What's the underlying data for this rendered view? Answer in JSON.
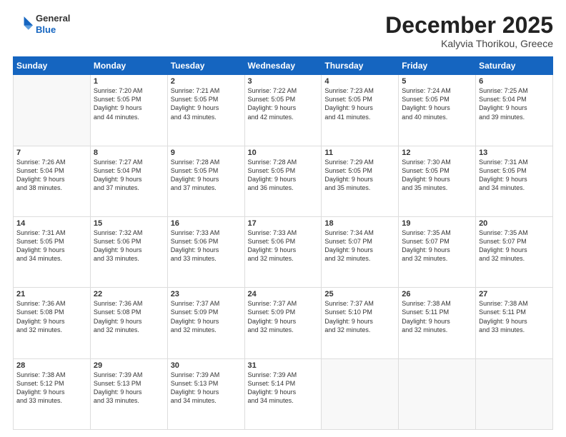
{
  "logo": {
    "general": "General",
    "blue": "Blue"
  },
  "header": {
    "month_year": "December 2025",
    "location": "Kalyvia Thorikou, Greece"
  },
  "days_of_week": [
    "Sunday",
    "Monday",
    "Tuesday",
    "Wednesday",
    "Thursday",
    "Friday",
    "Saturday"
  ],
  "weeks": [
    [
      {
        "day": "",
        "info": ""
      },
      {
        "day": "1",
        "info": "Sunrise: 7:20 AM\nSunset: 5:05 PM\nDaylight: 9 hours\nand 44 minutes."
      },
      {
        "day": "2",
        "info": "Sunrise: 7:21 AM\nSunset: 5:05 PM\nDaylight: 9 hours\nand 43 minutes."
      },
      {
        "day": "3",
        "info": "Sunrise: 7:22 AM\nSunset: 5:05 PM\nDaylight: 9 hours\nand 42 minutes."
      },
      {
        "day": "4",
        "info": "Sunrise: 7:23 AM\nSunset: 5:05 PM\nDaylight: 9 hours\nand 41 minutes."
      },
      {
        "day": "5",
        "info": "Sunrise: 7:24 AM\nSunset: 5:05 PM\nDaylight: 9 hours\nand 40 minutes."
      },
      {
        "day": "6",
        "info": "Sunrise: 7:25 AM\nSunset: 5:04 PM\nDaylight: 9 hours\nand 39 minutes."
      }
    ],
    [
      {
        "day": "7",
        "info": "Sunrise: 7:26 AM\nSunset: 5:04 PM\nDaylight: 9 hours\nand 38 minutes."
      },
      {
        "day": "8",
        "info": "Sunrise: 7:27 AM\nSunset: 5:04 PM\nDaylight: 9 hours\nand 37 minutes."
      },
      {
        "day": "9",
        "info": "Sunrise: 7:28 AM\nSunset: 5:05 PM\nDaylight: 9 hours\nand 37 minutes."
      },
      {
        "day": "10",
        "info": "Sunrise: 7:28 AM\nSunset: 5:05 PM\nDaylight: 9 hours\nand 36 minutes."
      },
      {
        "day": "11",
        "info": "Sunrise: 7:29 AM\nSunset: 5:05 PM\nDaylight: 9 hours\nand 35 minutes."
      },
      {
        "day": "12",
        "info": "Sunrise: 7:30 AM\nSunset: 5:05 PM\nDaylight: 9 hours\nand 35 minutes."
      },
      {
        "day": "13",
        "info": "Sunrise: 7:31 AM\nSunset: 5:05 PM\nDaylight: 9 hours\nand 34 minutes."
      }
    ],
    [
      {
        "day": "14",
        "info": "Sunrise: 7:31 AM\nSunset: 5:05 PM\nDaylight: 9 hours\nand 34 minutes."
      },
      {
        "day": "15",
        "info": "Sunrise: 7:32 AM\nSunset: 5:06 PM\nDaylight: 9 hours\nand 33 minutes."
      },
      {
        "day": "16",
        "info": "Sunrise: 7:33 AM\nSunset: 5:06 PM\nDaylight: 9 hours\nand 33 minutes."
      },
      {
        "day": "17",
        "info": "Sunrise: 7:33 AM\nSunset: 5:06 PM\nDaylight: 9 hours\nand 32 minutes."
      },
      {
        "day": "18",
        "info": "Sunrise: 7:34 AM\nSunset: 5:07 PM\nDaylight: 9 hours\nand 32 minutes."
      },
      {
        "day": "19",
        "info": "Sunrise: 7:35 AM\nSunset: 5:07 PM\nDaylight: 9 hours\nand 32 minutes."
      },
      {
        "day": "20",
        "info": "Sunrise: 7:35 AM\nSunset: 5:07 PM\nDaylight: 9 hours\nand 32 minutes."
      }
    ],
    [
      {
        "day": "21",
        "info": "Sunrise: 7:36 AM\nSunset: 5:08 PM\nDaylight: 9 hours\nand 32 minutes."
      },
      {
        "day": "22",
        "info": "Sunrise: 7:36 AM\nSunset: 5:08 PM\nDaylight: 9 hours\nand 32 minutes."
      },
      {
        "day": "23",
        "info": "Sunrise: 7:37 AM\nSunset: 5:09 PM\nDaylight: 9 hours\nand 32 minutes."
      },
      {
        "day": "24",
        "info": "Sunrise: 7:37 AM\nSunset: 5:09 PM\nDaylight: 9 hours\nand 32 minutes."
      },
      {
        "day": "25",
        "info": "Sunrise: 7:37 AM\nSunset: 5:10 PM\nDaylight: 9 hours\nand 32 minutes."
      },
      {
        "day": "26",
        "info": "Sunrise: 7:38 AM\nSunset: 5:11 PM\nDaylight: 9 hours\nand 32 minutes."
      },
      {
        "day": "27",
        "info": "Sunrise: 7:38 AM\nSunset: 5:11 PM\nDaylight: 9 hours\nand 33 minutes."
      }
    ],
    [
      {
        "day": "28",
        "info": "Sunrise: 7:38 AM\nSunset: 5:12 PM\nDaylight: 9 hours\nand 33 minutes."
      },
      {
        "day": "29",
        "info": "Sunrise: 7:39 AM\nSunset: 5:13 PM\nDaylight: 9 hours\nand 33 minutes."
      },
      {
        "day": "30",
        "info": "Sunrise: 7:39 AM\nSunset: 5:13 PM\nDaylight: 9 hours\nand 34 minutes."
      },
      {
        "day": "31",
        "info": "Sunrise: 7:39 AM\nSunset: 5:14 PM\nDaylight: 9 hours\nand 34 minutes."
      },
      {
        "day": "",
        "info": ""
      },
      {
        "day": "",
        "info": ""
      },
      {
        "day": "",
        "info": ""
      }
    ]
  ]
}
